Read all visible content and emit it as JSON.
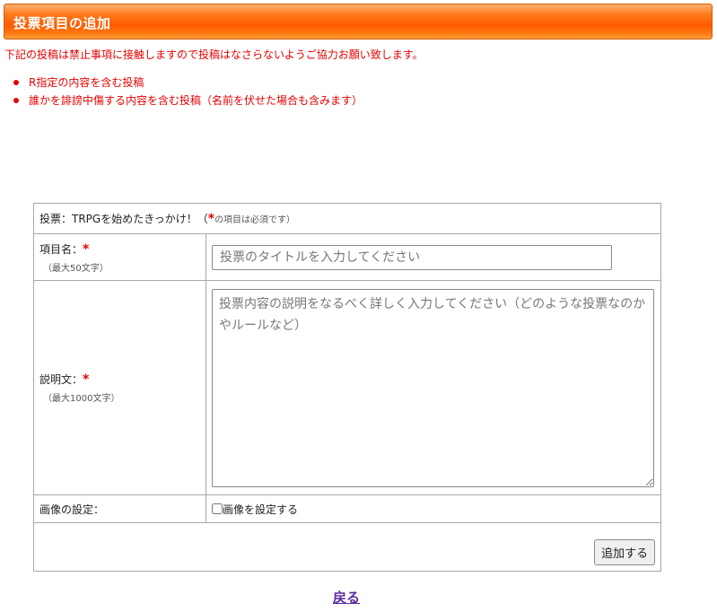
{
  "header": {
    "title": "投票項目の追加"
  },
  "notice": {
    "text": "下記の投稿は禁止事項に接触しますので投稿はなさらないようご協力お願い致します。",
    "rules": [
      "R指定の内容を含む投稿",
      "誰かを誹謗中傷する内容を含む投稿（名前を伏せた場合も含みます）"
    ]
  },
  "form": {
    "caption_prefix": "投票：TRPGを始めたきっかけ！（",
    "caption_required_mark": "*",
    "caption_suffix": "の項目は必須です）",
    "title_label": "項目名：",
    "title_required_mark": "*",
    "title_limit": "（最大50文字）",
    "title_placeholder": "投票のタイトルを入力してください",
    "title_value": "",
    "desc_label": "説明文：",
    "desc_required_mark": "*",
    "desc_limit": "（最大1000文字）",
    "desc_placeholder": "投票内容の説明をなるべく詳しく入力してください（どのような投票なのかやルールなど）",
    "desc_value": "",
    "image_label": "画像の設定：",
    "image_checkbox_label": "画像を設定する",
    "image_checked": false,
    "submit_label": "追加する"
  },
  "footer": {
    "back_label": "戻る"
  },
  "colors": {
    "header_orange": "#ff6a00",
    "notice_red": "#e60000",
    "link_purple": "#5a2aa0",
    "border_gray": "#a8a8a8"
  }
}
